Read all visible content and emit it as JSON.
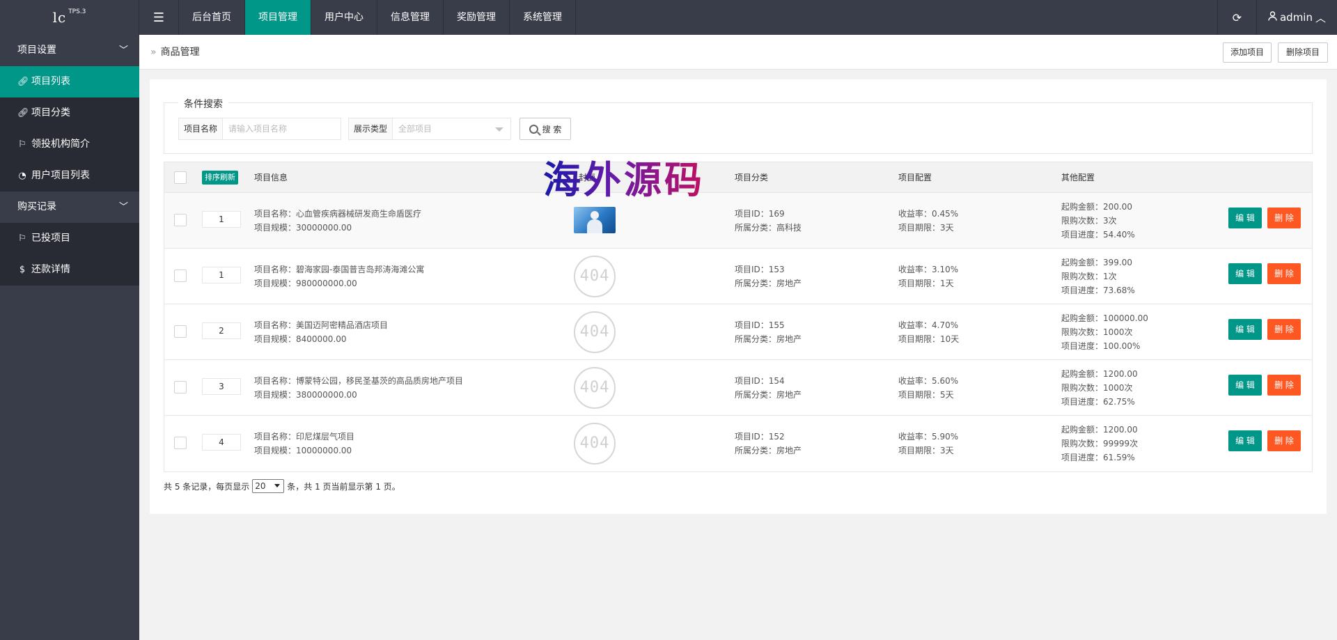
{
  "header": {
    "logo_text": "lc",
    "logo_version": "TPS.3",
    "nav": [
      {
        "label": "后台首页",
        "active": false
      },
      {
        "label": "项目管理",
        "active": true
      },
      {
        "label": "用户中心",
        "active": false
      },
      {
        "label": "信息管理",
        "active": false
      },
      {
        "label": "奖励管理",
        "active": false
      },
      {
        "label": "系统管理",
        "active": false
      }
    ],
    "user": "admin"
  },
  "sidebar": {
    "groups": [
      {
        "label": "项目设置",
        "items": [
          {
            "label": "项目列表",
            "icon": "link-icon",
            "active": true
          },
          {
            "label": "项目分类",
            "icon": "link-icon",
            "active": false
          },
          {
            "label": "领投机构简介",
            "icon": "flag-icon",
            "active": false
          },
          {
            "label": "用户项目列表",
            "icon": "dashboard-icon",
            "active": false
          }
        ]
      },
      {
        "label": "购买记录",
        "items": [
          {
            "label": "已投项目",
            "icon": "flag-icon",
            "active": false
          },
          {
            "label": "还款详情",
            "icon": "dollar-icon",
            "active": false
          }
        ]
      }
    ]
  },
  "breadcrumb": "商品管理",
  "actions": {
    "add": "添加项目",
    "delete": "删除项目"
  },
  "search": {
    "legend": "条件搜索",
    "name_label": "项目名称",
    "name_placeholder": "请输入项目名称",
    "type_label": "展示类型",
    "type_value": "全部项目",
    "button": "搜 索"
  },
  "table": {
    "sort_button": "排序刷新",
    "headers": {
      "info": "项目信息",
      "image": "封面",
      "category": "项目分类",
      "config": "项目配置",
      "other": "其他配置"
    },
    "edit_label": "编 辑",
    "delete_label": "删 除",
    "rows": [
      {
        "sort": "1",
        "name": "项目名称：心血管疾病器械研发商生命盾医疗",
        "scale": "项目规模：30000000.00",
        "image": "photo",
        "id": "项目ID：169",
        "cat": "所属分类：高科技",
        "rate": "收益率：0.45%",
        "term": "项目期限：3天",
        "min": "起购金额：200.00",
        "limit": "限购次数：3次",
        "progress": "项目进度：54.40%"
      },
      {
        "sort": "1",
        "name": "项目名称：碧海家园-泰国普吉岛邦涛海滩公寓",
        "scale": "项目规模：980000000.00",
        "image": "404",
        "id": "项目ID：153",
        "cat": "所属分类：房地产",
        "rate": "收益率：3.10%",
        "term": "项目期限：1天",
        "min": "起购金额：399.00",
        "limit": "限购次数：1次",
        "progress": "项目进度：73.68%"
      },
      {
        "sort": "2",
        "name": "项目名称：美国迈阿密精品酒店项目",
        "scale": "项目规模：8400000.00",
        "image": "404",
        "id": "项目ID：155",
        "cat": "所属分类：房地产",
        "rate": "收益率：4.70%",
        "term": "项目期限：10天",
        "min": "起购金额：100000.00",
        "limit": "限购次数：1000次",
        "progress": "项目进度：100.00%"
      },
      {
        "sort": "3",
        "name": "项目名称：博蒙特公园，移民圣基茨的高品质房地产项目",
        "scale": "项目规模：380000000.00",
        "image": "404",
        "id": "项目ID：154",
        "cat": "所属分类：房地产",
        "rate": "收益率：5.60%",
        "term": "项目期限：5天",
        "min": "起购金额：1200.00",
        "limit": "限购次数：1000次",
        "progress": "项目进度：62.75%"
      },
      {
        "sort": "4",
        "name": "项目名称：印尼煤层气项目",
        "scale": "项目规模：10000000.00",
        "image": "404",
        "id": "项目ID：152",
        "cat": "所属分类：房地产",
        "rate": "收益率：5.90%",
        "term": "项目期限：3天",
        "min": "起购金额：1200.00",
        "limit": "限购次数：99999次",
        "progress": "项目进度：61.59%"
      }
    ]
  },
  "pager": {
    "prefix": "共 5 条记录，每页显示",
    "per_page": "20",
    "suffix": "条，共 1 页当前显示第 1 页。"
  },
  "placeholder_404": "404",
  "watermark": "海外源码"
}
